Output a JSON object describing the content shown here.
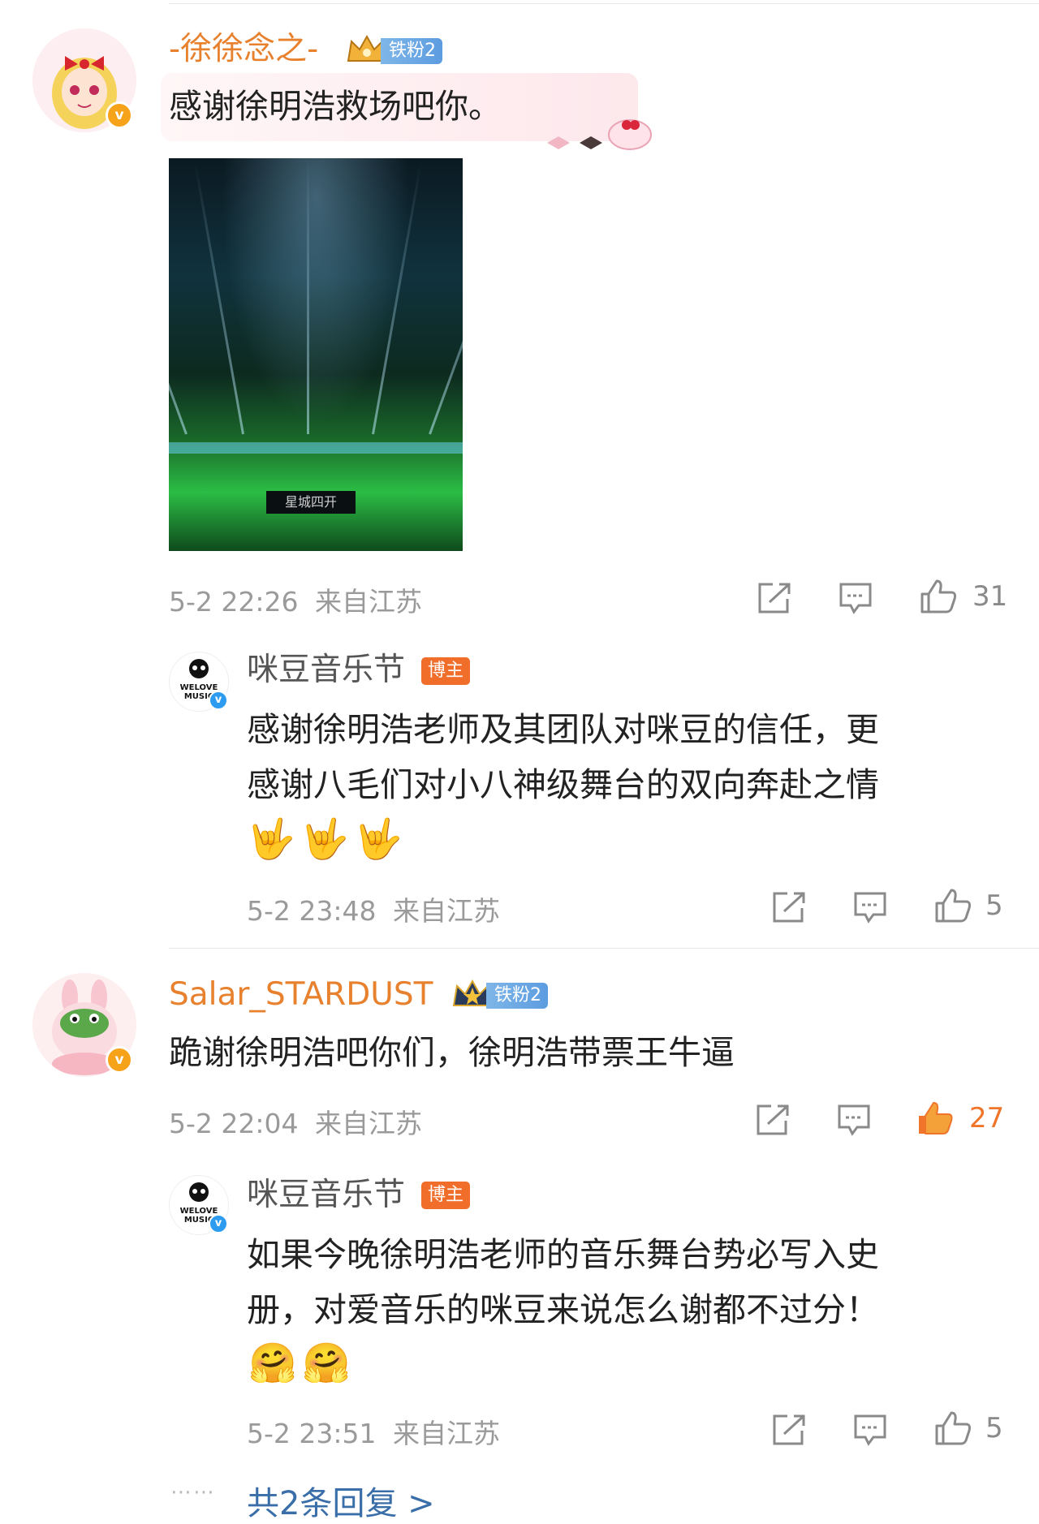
{
  "comments": [
    {
      "user": "-徐徐念之-",
      "fan_badge": "铁粉2",
      "text": "感谢徐明浩救场吧你。",
      "time": "5-2 22:26",
      "location": "来自江苏",
      "likes": "31",
      "image_text": "星城四开",
      "reply": {
        "user": "咪豆音乐节",
        "tag": "博主",
        "text_line1": "感谢徐明浩老师及其团队对咪豆的信任，更",
        "text_line2": "感谢八毛们对小八神级舞台的双向奔赴之情",
        "emojis": "🤟",
        "time": "5-2 23:48",
        "location": "来自江苏",
        "likes": "5"
      }
    },
    {
      "user": "Salar_STARDUST",
      "fan_badge": "铁粉2",
      "text": "跪谢徐明浩吧你们，徐明浩带票王牛逼",
      "time": "5-2 22:04",
      "location": "来自江苏",
      "likes": "27",
      "reply": {
        "user": "咪豆音乐节",
        "tag": "博主",
        "text_line1": "如果今晚徐明浩老师的音乐舞台势必写入史",
        "text_line2": "册，对爱音乐的咪豆来说怎么谢都不过分！",
        "emojis": "🤗",
        "time": "5-2 23:51",
        "location": "来自江苏",
        "likes": "5"
      },
      "more_replies": "共2条回复 >"
    }
  ],
  "avatar_logo_text": "WELOVE MUSIC",
  "colors": {
    "username_orange": "#e8812e",
    "meta_gray": "#9a9a9a",
    "owner_tag": "#f06d2a",
    "link_blue": "#3a6ea8",
    "like_active": "#f0742a"
  },
  "icons": [
    "share-icon",
    "comment-icon",
    "like-icon",
    "verified-icon",
    "crown-icon"
  ]
}
